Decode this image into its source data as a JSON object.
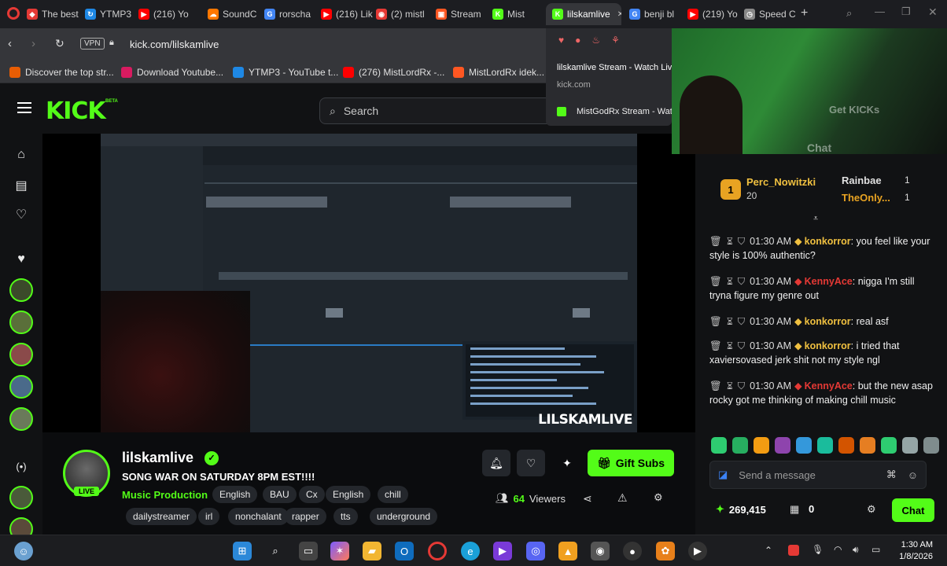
{
  "browser": {
    "tabs": [
      {
        "label": "The best",
        "color": "#e53935",
        "glyph": "◆"
      },
      {
        "label": "YTMP3",
        "color": "#1e88e5",
        "glyph": "↻"
      },
      {
        "label": "(216) Yo",
        "color": "#ff0000",
        "glyph": "▶"
      },
      {
        "label": "SoundC",
        "color": "#ff7700",
        "glyph": "☁"
      },
      {
        "label": "rorscha",
        "color": "#4285f4",
        "glyph": "G"
      },
      {
        "label": "(216) Lik",
        "color": "#ff0000",
        "glyph": "▶"
      },
      {
        "label": "(2) mistl",
        "color": "#e53935",
        "glyph": "◉"
      },
      {
        "label": "Stream",
        "color": "#ff5722",
        "glyph": "▣"
      },
      {
        "label": "Mist",
        "color": "#53fc18",
        "glyph": "K"
      },
      {
        "label": "lilskamlive",
        "color": "#53fc18",
        "glyph": "K"
      },
      {
        "label": "benji bl",
        "color": "#4285f4",
        "glyph": "G"
      },
      {
        "label": "(219) Yo",
        "color": "#ff0000",
        "glyph": "▶"
      },
      {
        "label": "Speed C",
        "color": "#888888",
        "glyph": "◷"
      }
    ],
    "vpn_label": "VPN",
    "url": "kick.com/lilskamlive",
    "bookmarks": [
      {
        "label": "Discover the top str...",
        "color": "#e85d04"
      },
      {
        "label": "Download Youtube...",
        "color": "#d81b60"
      },
      {
        "label": "YTMP3 - YouTube t...",
        "color": "#1e88e5"
      },
      {
        "label": "(276) MistLordRx -...",
        "color": "#ff0000"
      },
      {
        "label": "MistLordRx idek...",
        "color": "#ff5722"
      }
    ],
    "tab_preview": {
      "title": "lilskamlive Stream - Watch Live on Kick",
      "domain": "kick.com",
      "other_tab": "MistGodRx Stream - Watch Live on Kick"
    }
  },
  "kick": {
    "logo": "KICK",
    "beta": "BETA",
    "search_placeholder": "Search",
    "brand_color": "#53fc18"
  },
  "video": {
    "watermark": "LILSKAMLIVE"
  },
  "stream": {
    "streamer": "lilskamlive",
    "live_badge": "LIVE",
    "title": "SONG WAR ON SATURDAY 8PM EST!!!!",
    "category": "Music Production",
    "tags_row1": [
      "English",
      "BAU",
      "Cx",
      "English",
      "chill"
    ],
    "tags_row2": [
      "dailystreamer",
      "irl",
      "nonchalant",
      "rapper",
      "tts",
      "underground"
    ],
    "gift_subs_label": "Gift Subs",
    "viewers_count": "64",
    "viewers_label": "Viewers"
  },
  "chat": {
    "webcam_overlay": {
      "get_kicks": "Get KICKs",
      "chat_label": "Chat"
    },
    "leaderboard": {
      "first": {
        "name": "Perc_Nowitzki",
        "score": "20"
      },
      "second": {
        "name": "Rainbae",
        "score": "1"
      },
      "third": {
        "name": "TheOnly...",
        "score": "1"
      }
    },
    "messages": [
      {
        "time": "01:30 AM",
        "user": "konkorror",
        "user_color": "#f0c040",
        "text": "you feel like your style is 100% authentic?"
      },
      {
        "time": "01:30 AM",
        "user": "KennyAce",
        "user_color": "#e53935",
        "text": "nigga I'm still tryna figure my genre out"
      },
      {
        "time": "01:30 AM",
        "user": "konkorror",
        "user_color": "#f0c040",
        "text": "real asf"
      },
      {
        "time": "01:30 AM",
        "user": "konkorror",
        "user_color": "#f0c040",
        "text": "i tried that xaviersovased jerk shit not my style ngl"
      },
      {
        "time": "01:30 AM",
        "user": "KennyAce",
        "user_color": "#e53935",
        "text": "but the new asap rocky got me thinking of making chill music"
      }
    ],
    "input_placeholder": "Send a message",
    "points": "269,415",
    "points_secondary": "0",
    "chat_button": "Chat"
  },
  "taskbar": {
    "time": "1:30 AM",
    "date": "1/8/2026"
  }
}
